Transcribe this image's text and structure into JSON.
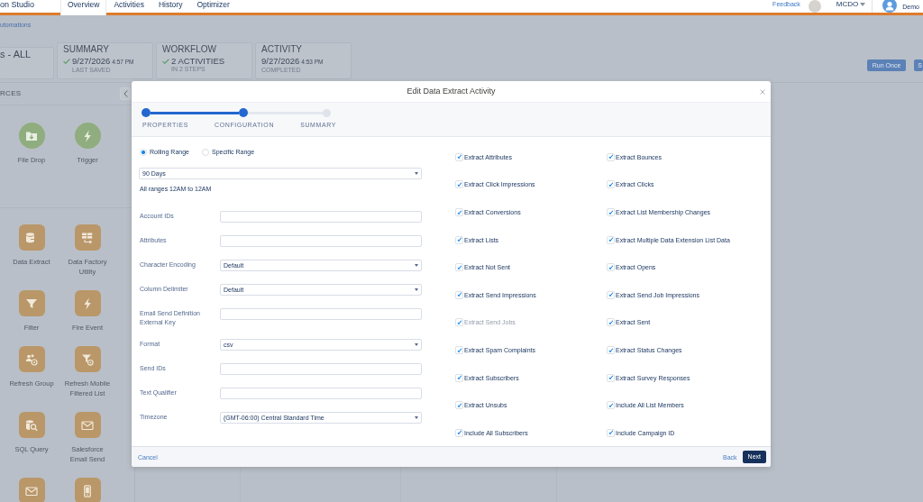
{
  "app_bar": {
    "title": "on Studio",
    "tabs": [
      {
        "label": "Overview",
        "selected": true
      },
      {
        "label": "Activities",
        "selected": false
      },
      {
        "label": "History",
        "selected": false
      },
      {
        "label": "Optimizer",
        "selected": false
      }
    ],
    "feedback": "Feedback",
    "org": "MCDO",
    "user": "Demo"
  },
  "breadcrumb": "utomations",
  "cards": [
    {
      "kind": "name",
      "title": "s - ALL"
    },
    {
      "kind": "status",
      "title": "SUMMARY",
      "checked": true,
      "value": "9/27/2026",
      "time": "4:57 PM",
      "caption": "LAST SAVED"
    },
    {
      "kind": "status",
      "title": "WORKFLOW",
      "checked": true,
      "value": "2 ACTIVITIES",
      "caption": "IN 2 STEPS"
    },
    {
      "kind": "status",
      "title": "ACTIVITY",
      "checked": false,
      "value": "9/27/2026",
      "time": "4:53 PM",
      "caption": "COMPLETED"
    }
  ],
  "actions": [
    "Run Once",
    "S"
  ],
  "sidebar": {
    "title": "RCES",
    "groups": [
      {
        "items": [
          {
            "kind": "starter",
            "label": "File Drop"
          },
          {
            "kind": "starter",
            "label": "Trigger"
          }
        ]
      },
      {
        "items": [
          {
            "kind": "activity",
            "label": "Data Extract"
          },
          {
            "kind": "activity",
            "label": "Data Factory Utility"
          },
          {
            "kind": "activity",
            "label": "Filter"
          },
          {
            "kind": "activity",
            "label": "Fire Event"
          },
          {
            "kind": "activity",
            "label": "Refresh Group"
          },
          {
            "kind": "activity",
            "label": "Refresh Mobile Filtered List"
          },
          {
            "kind": "activity",
            "label": "SQL Query"
          },
          {
            "kind": "activity",
            "label": "Salesforce Email Send"
          },
          {
            "kind": "activity"
          },
          {
            "kind": "activity"
          }
        ]
      }
    ]
  },
  "modal": {
    "title": "Edit Data Extract Activity",
    "steps": [
      {
        "label": "PROPERTIES",
        "done": true
      },
      {
        "label": "CONFIGURATION",
        "done": true
      },
      {
        "label": "SUMMARY",
        "done": false
      }
    ],
    "range_options": [
      {
        "label": "Rolling Range",
        "selected": true
      },
      {
        "label": "Specific Range",
        "selected": false
      }
    ],
    "range_select": "90 Days",
    "range_note": "All ranges 12AM to 12AM",
    "fields": [
      {
        "label": "Account IDs",
        "kind": "text"
      },
      {
        "label": "Attributes",
        "kind": "text"
      },
      {
        "label": "Character Encoding",
        "kind": "select",
        "value": "Default"
      },
      {
        "label": "Column Delimiter",
        "kind": "select",
        "value": "Default"
      },
      {
        "label": "Email Send Definition External Key",
        "kind": "text"
      },
      {
        "label": "Format",
        "kind": "select",
        "value": "csv"
      },
      {
        "label": "Send IDs",
        "kind": "text"
      },
      {
        "label": "Text Qualifier",
        "kind": "text"
      },
      {
        "label": "Timezone",
        "kind": "select",
        "value": "(GMT-06:00) Central Standard Time"
      }
    ],
    "options": [
      {
        "label": "Extract Attributes",
        "checked": true,
        "disabled": false
      },
      {
        "label": "Extract Bounces",
        "checked": true,
        "disabled": false
      },
      {
        "label": "Extract Click Impressions",
        "checked": true,
        "disabled": false
      },
      {
        "label": "Extract Clicks",
        "checked": true,
        "disabled": false
      },
      {
        "label": "Extract Conversions",
        "checked": true,
        "disabled": false
      },
      {
        "label": "Extract List Membership Changes",
        "checked": true,
        "disabled": false
      },
      {
        "label": "Extract Lists",
        "checked": true,
        "disabled": false
      },
      {
        "label": "Extract Multiple Data Extension List Data",
        "checked": true,
        "disabled": false
      },
      {
        "label": "Extract Not Sent",
        "checked": true,
        "disabled": false
      },
      {
        "label": "Extract Opens",
        "checked": true,
        "disabled": false
      },
      {
        "label": "Extract Send Impressions",
        "checked": true,
        "disabled": false
      },
      {
        "label": "Extract Send Job Impressions",
        "checked": true,
        "disabled": false
      },
      {
        "label": "Extract Send Jobs",
        "checked": true,
        "disabled": true
      },
      {
        "label": "Extract Sent",
        "checked": true,
        "disabled": false
      },
      {
        "label": "Extract Spam Complaints",
        "checked": true,
        "disabled": false
      },
      {
        "label": "Extract Status Changes",
        "checked": true,
        "disabled": false
      },
      {
        "label": "Extract Subscribers",
        "checked": true,
        "disabled": false
      },
      {
        "label": "Extract Survey Responses",
        "checked": true,
        "disabled": false
      },
      {
        "label": "Extract Unsubs",
        "checked": true,
        "disabled": false
      },
      {
        "label": "Include All List Members",
        "checked": true,
        "disabled": false
      },
      {
        "label": "Include All Subscribers",
        "checked": true,
        "disabled": false
      },
      {
        "label": "Include Campaign ID",
        "checked": true,
        "disabled": false
      }
    ],
    "cancel": "Cancel",
    "back": "Back",
    "next": "Next"
  }
}
